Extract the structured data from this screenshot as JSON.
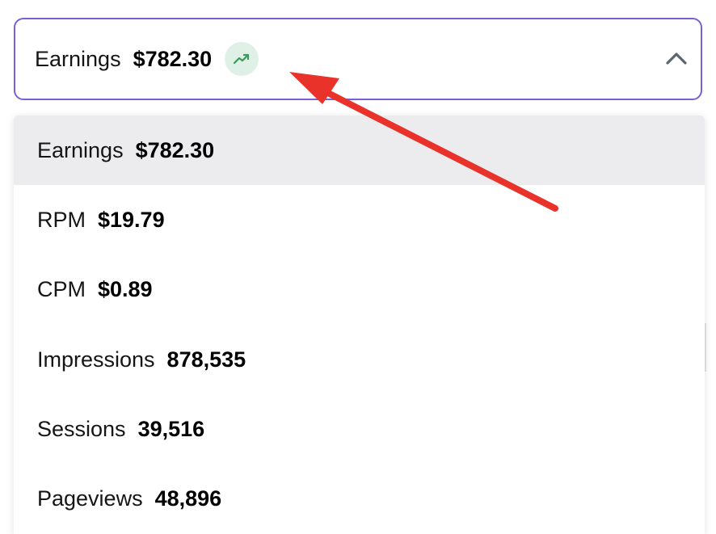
{
  "selected": {
    "label": "Earnings",
    "value": "$782.30",
    "trend_icon": "trending-up-icon",
    "trend_color": "#3a9a5c",
    "chevron_icon": "chevron-up-icon"
  },
  "options": [
    {
      "label": "Earnings",
      "value": "$782.30",
      "selected": true
    },
    {
      "label": "RPM",
      "value": "$19.79",
      "selected": false
    },
    {
      "label": "CPM",
      "value": "$0.89",
      "selected": false
    },
    {
      "label": "Impressions",
      "value": "878,535",
      "selected": false
    },
    {
      "label": "Sessions",
      "value": "39,516",
      "selected": false
    },
    {
      "label": "Pageviews",
      "value": "48,896",
      "selected": false
    }
  ],
  "colors": {
    "border_accent": "#7a5fd6",
    "selected_bg": "#ececef",
    "annotation_arrow": "#e8322a",
    "badge_bg": "#dff1e6"
  },
  "annotation": {
    "type": "arrow",
    "points_to": "trending-up-icon"
  }
}
